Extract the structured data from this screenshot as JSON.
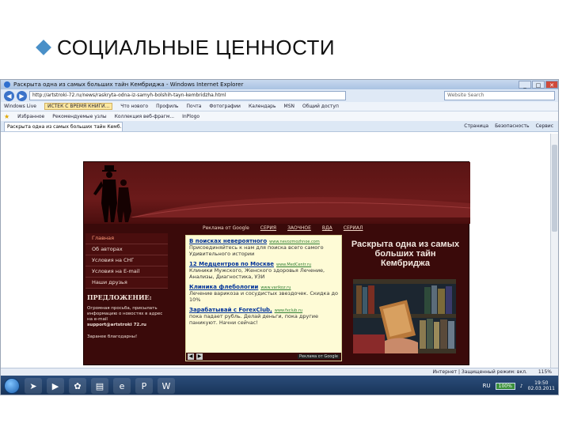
{
  "slide": {
    "title": "СОЦИАЛЬНЫЕ ЦЕННОСТИ"
  },
  "browser": {
    "window_title": "Раскрыта одна из самых больших тайн Кембриджа - Windows Internet Explorer",
    "address": "http://artstroki-72.ru/news/raskryta-odna-iz-samyh-bolshih-tayn-kembridzha.html",
    "search_placeholder": "Website Search",
    "links_bar": [
      "Windows Live",
      "ИСТЕК С ВРЕМЯ КНИГИ...",
      "Что нового",
      "Профиль",
      "Почта",
      "Фотографии",
      "Календарь",
      "MSN",
      "Общий доступ"
    ],
    "favorites": {
      "label": "Избранное",
      "items": [
        "Рекомендуемые узлы",
        "Коллекция веб-фрагм...",
        "InPlogo"
      ]
    },
    "tab_title": "Раскрыта одна из самых больших тайн Кемб...",
    "tab_tools": [
      "Страница",
      "Безопасность",
      "Сервис"
    ],
    "status": [
      "Интернет | Защищенный режим: вкл.",
      "115%"
    ]
  },
  "site": {
    "ad_nav": {
      "label": "Реклама от Google",
      "items": [
        "СЕРИЯ",
        "ЗАОЧНОЕ",
        "ВДА",
        "СЕРИАЛ"
      ]
    },
    "left_nav": [
      "Главная",
      "Об авторах",
      "Условия на СНГ",
      "Условия на E-mail",
      "Наши друзья"
    ],
    "offer": {
      "title": "ПРЕДЛОЖЕНИЕ:",
      "text": "Огромная просьба, присылать информацию о новостях в адрес на e-mail",
      "email": "support@artstroki 72.ru",
      "thanks": "Заранее благодарны!"
    },
    "ads": [
      {
        "title": "В поисках невероятного",
        "url": "www.nevozmozhnoe.com",
        "text": "Присоединяйтесь к нам для поиска всего самого Удивительного истории"
      },
      {
        "title": "12 Медцентров по Москве",
        "url": "www.MedCentr.ru",
        "text": "Клиники Мужского, Женского здоровья Лечение, Анализы, Диагностика, УЗИ"
      },
      {
        "title": "Клиника флебологии",
        "url": "www.varikoz.ru",
        "text": "Лечение варикоза и сосудистых звездочек. Скидка до 10%"
      },
      {
        "title": "Зарабатывай с ForexClub,",
        "url": "www.fxclub.ru",
        "text": "пока падает рубль. Делай деньги, пока другие паникуют. Начни сейчас!"
      }
    ],
    "ads_badge": "Реклама от Google",
    "headline": "Раскрыта одна из самых больших тайн Кембриджа"
  },
  "taskbar": {
    "lang": "RU",
    "battery": "100%",
    "time": "19:50",
    "date": "02.03.2011"
  }
}
